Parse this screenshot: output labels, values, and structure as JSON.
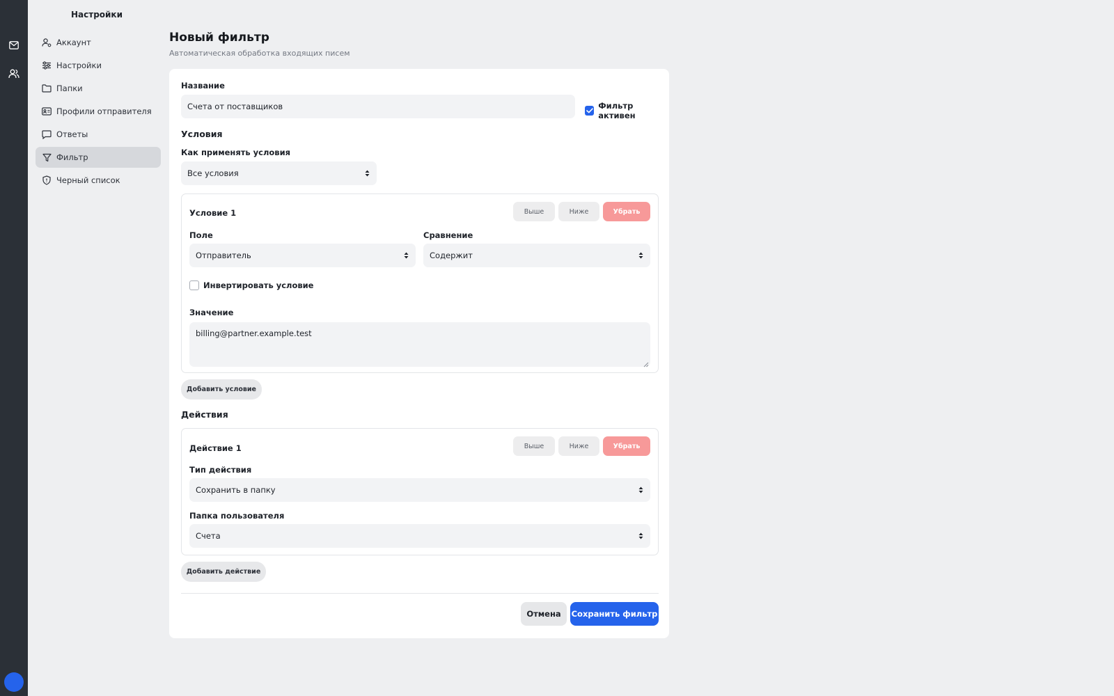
{
  "rail": {
    "icons": [
      "mail-icon",
      "users-icon"
    ],
    "accent": "#2563eb"
  },
  "sidebar": {
    "title": "Настройки",
    "items": [
      {
        "label": "Аккаунт",
        "icon": "user-icon"
      },
      {
        "label": "Настройки",
        "icon": "sliders-icon"
      },
      {
        "label": "Папки",
        "icon": "folder-icon"
      },
      {
        "label": "Профили отправителя",
        "icon": "id-card-icon"
      },
      {
        "label": "Ответы",
        "icon": "chat-icon"
      },
      {
        "label": "Фильтр",
        "icon": "filter-icon",
        "active": true
      },
      {
        "label": "Черный список",
        "icon": "shield-icon"
      }
    ]
  },
  "header": {
    "title": "Новый фильтр",
    "subtitle": "Автоматическая обработка входящих писем"
  },
  "form": {
    "name_label": "Название",
    "name_value": "Счета от поставщиков",
    "active_label": "Фильтр активен",
    "active_checked": true,
    "conditions_title": "Условия",
    "apply_label": "Как применять условия",
    "apply_value": "Все условия",
    "condition": {
      "title": "Условие 1",
      "up_label": "Выше",
      "down_label": "Ниже",
      "remove_label": "Убрать",
      "field_label": "Поле",
      "field_value": "Отправитель",
      "compare_label": "Сравнение",
      "compare_value": "Содержит",
      "invert_label": "Инвертировать условие",
      "invert_checked": false,
      "value_label": "Значение",
      "value": "billing@partner.example.test"
    },
    "add_condition_label": "Добавить условие",
    "actions_title": "Действия",
    "action": {
      "title": "Действие 1",
      "up_label": "Выше",
      "down_label": "Ниже",
      "remove_label": "Убрать",
      "type_label": "Тип действия",
      "type_value": "Сохранить в папку",
      "folder_label": "Папка пользователя",
      "folder_value": "Счета"
    },
    "add_action_label": "Добавить действие",
    "cancel_label": "Отмена",
    "save_label": "Сохранить фильтр"
  },
  "colors": {
    "primary": "#2563eb",
    "danger": "#f79999",
    "rail": "#2b3037",
    "background": "#eeeff1"
  }
}
